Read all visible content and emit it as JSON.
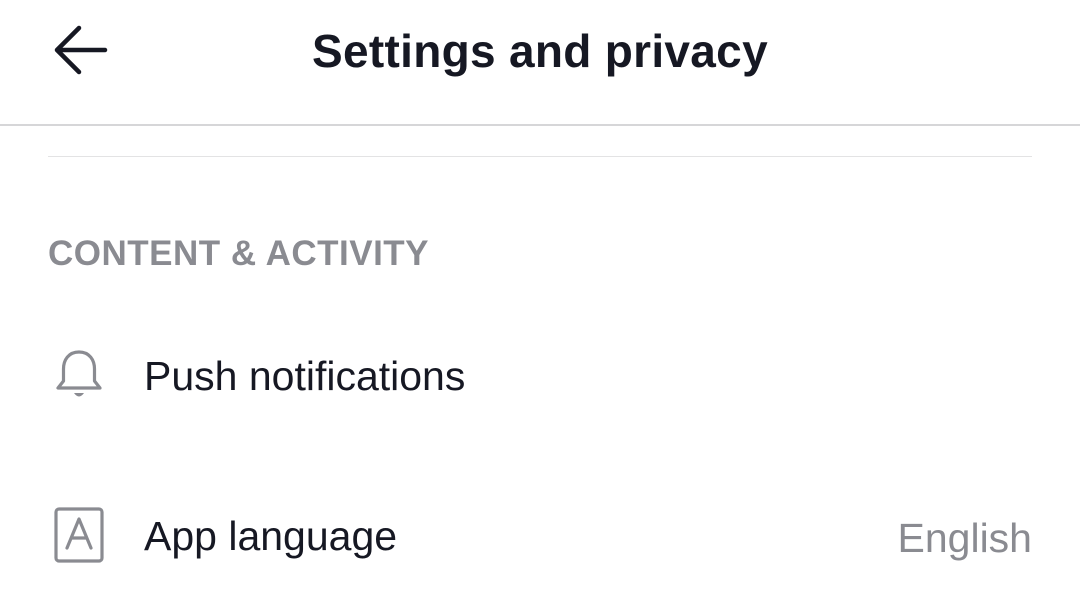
{
  "header": {
    "title": "Settings and privacy",
    "back_icon": "arrow-left-icon"
  },
  "sections": [
    {
      "label": "CONTENT & ACTIVITY",
      "items": [
        {
          "label": "Push notifications",
          "icon": "bell-icon",
          "value": ""
        },
        {
          "label": "App language",
          "icon": "language-a-icon",
          "value": "English"
        }
      ]
    }
  ],
  "colors": {
    "text_primary": "#161823",
    "text_secondary": "#8a8b91",
    "icon": "#8a8b91",
    "divider": "#d6d6d8",
    "background": "#ffffff"
  }
}
